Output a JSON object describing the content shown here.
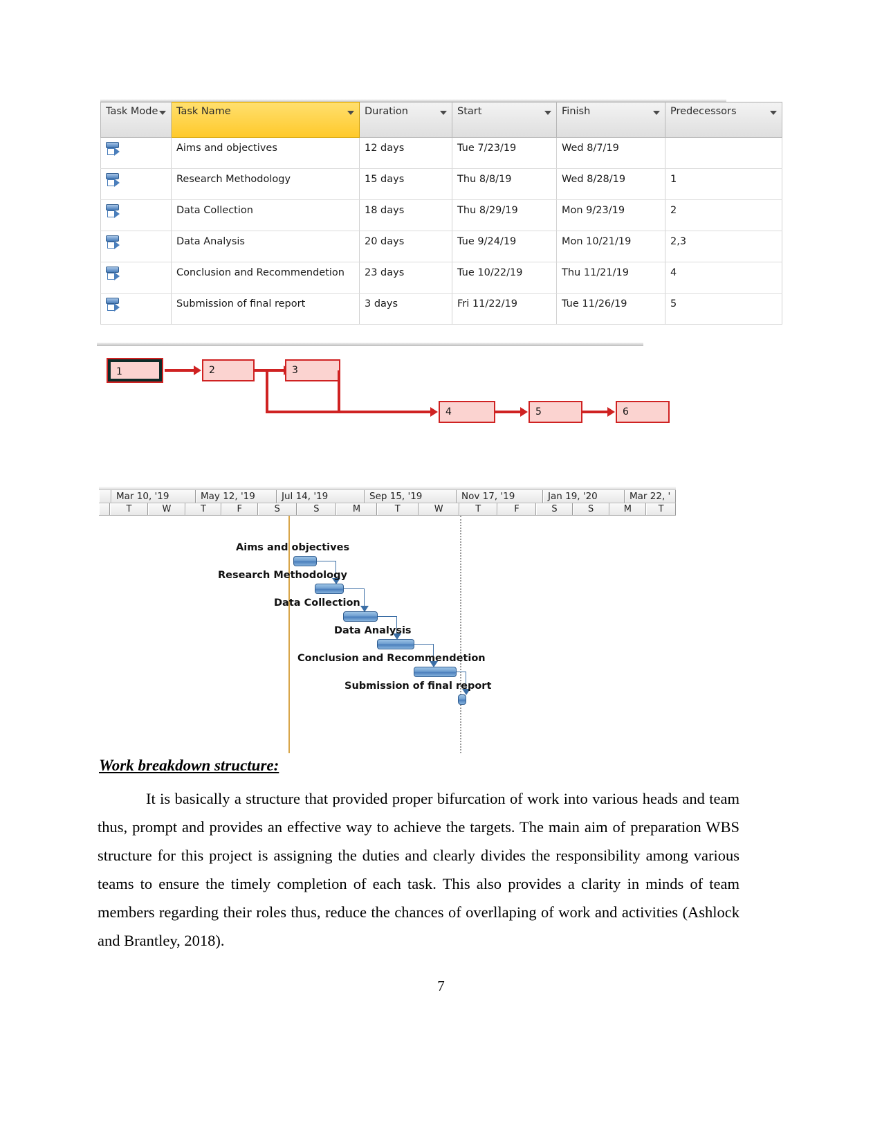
{
  "task_table": {
    "columns": [
      {
        "key": "task_mode",
        "label": "Task Mode",
        "highlight": false
      },
      {
        "key": "task_name",
        "label": "Task Name",
        "highlight": true
      },
      {
        "key": "duration",
        "label": "Duration",
        "highlight": false
      },
      {
        "key": "start",
        "label": "Start",
        "highlight": false
      },
      {
        "key": "finish",
        "label": "Finish",
        "highlight": false
      },
      {
        "key": "predecessors",
        "label": "Predecessors",
        "highlight": false
      }
    ],
    "rows": [
      {
        "mode_icon": "auto-schedule-icon",
        "task_name": "Aims and objectives",
        "duration": "12 days",
        "start": "Tue 7/23/19",
        "finish": "Wed 8/7/19",
        "predecessors": ""
      },
      {
        "mode_icon": "auto-schedule-icon",
        "task_name": "Research Methodology",
        "duration": "15 days",
        "start": "Thu 8/8/19",
        "finish": "Wed 8/28/19",
        "predecessors": "1"
      },
      {
        "mode_icon": "auto-schedule-icon",
        "task_name": "Data Collection",
        "duration": "18 days",
        "start": "Thu 8/29/19",
        "finish": "Mon 9/23/19",
        "predecessors": "2"
      },
      {
        "mode_icon": "auto-schedule-icon",
        "task_name": "Data Analysis",
        "duration": "20 days",
        "start": "Tue 9/24/19",
        "finish": "Mon 10/21/19",
        "predecessors": "2,3"
      },
      {
        "mode_icon": "auto-schedule-icon",
        "task_name": "Conclusion and Recommendetion",
        "duration": "23 days",
        "start": "Tue 10/22/19",
        "finish": "Thu 11/21/19",
        "predecessors": "4"
      },
      {
        "mode_icon": "auto-schedule-icon",
        "task_name": "Submission of final report",
        "duration": "3 days",
        "start": "Fri 11/22/19",
        "finish": "Tue 11/26/19",
        "predecessors": "5"
      }
    ]
  },
  "network_diagram": {
    "nodes": [
      {
        "id": "1",
        "label": "1",
        "critical": true
      },
      {
        "id": "2",
        "label": "2",
        "critical": false
      },
      {
        "id": "3",
        "label": "3",
        "critical": false
      },
      {
        "id": "4",
        "label": "4",
        "critical": false
      },
      {
        "id": "5",
        "label": "5",
        "critical": false
      },
      {
        "id": "6",
        "label": "6",
        "critical": false
      }
    ],
    "edges": [
      {
        "from": "1",
        "to": "2"
      },
      {
        "from": "2",
        "to": "3"
      },
      {
        "from": "2",
        "to": "4"
      },
      {
        "from": "3",
        "to": "4"
      },
      {
        "from": "4",
        "to": "5"
      },
      {
        "from": "5",
        "to": "6"
      }
    ],
    "box_fill": "#fbd3d0",
    "box_border": "#cf2222"
  },
  "gantt": {
    "timeline_major": [
      "Mar 10, '19",
      "May 12, '19",
      "Jul 14, '19",
      "Sep 15, '19",
      "Nov 17, '19",
      "Jan 19, '20",
      "Mar 22, '"
    ],
    "timeline_minor": [
      "T",
      "W",
      "T",
      "F",
      "S",
      "S",
      "M",
      "T",
      "W",
      "T",
      "F",
      "S",
      "S",
      "M",
      "T"
    ],
    "tasks": [
      {
        "label": "Aims and objectives",
        "bar_color": "#4a7ebb"
      },
      {
        "label": "Research Methodology",
        "bar_color": "#4a7ebb"
      },
      {
        "label": "Data Collection",
        "bar_color": "#4a7ebb"
      },
      {
        "label": "Data Analysis",
        "bar_color": "#4a7ebb"
      },
      {
        "label": "Conclusion and Recommendetion",
        "bar_color": "#4a7ebb"
      },
      {
        "label": "Submission of final report",
        "bar_color": "#4a7ebb"
      }
    ]
  },
  "content": {
    "heading": "Work breakdown structure:",
    "paragraph": "It is basically a structure that provided proper bifurcation of work into various heads and team thus, prompt and provides an effective way to achieve the targets. The main aim of preparation WBS structure for this project is assigning the duties and clearly divides the responsibility among various teams to ensure the timely completion of each task. This also provides a clarity in minds of team members regarding their roles thus, reduce the chances of overllaping of work and activities (Ashlock and Brantley, 2018).",
    "page_number": "7"
  }
}
